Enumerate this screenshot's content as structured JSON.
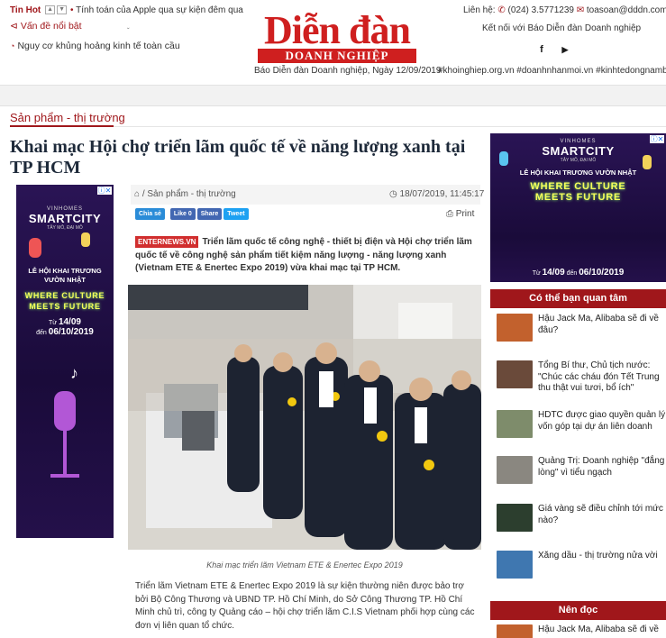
{
  "header": {
    "left_links": [
      "Vấn đề nổi bật",
      "Nguy cơ khủng hoảng kinh tế toàn cầu"
    ],
    "logo_main": "Diễn đàn",
    "logo_sub": "DOANH NGHIỆP",
    "date_line": "Báo Diễn đàn Doanh nghiệp, Ngày 12/09/2019",
    "connect": "Kết nối với Báo Diễn đàn Doanh nghiệp",
    "tags": "#khoinghiep.org.vn #doanhnhanmoi.vn #kinhtedongnambo.org"
  },
  "hotbar": {
    "label": "Tin Hot",
    "news": "Tính toán của Apple qua sự kiện đêm qua",
    "contact_label": "Liên hệ:",
    "phone": "(024) 3.5771239",
    "email": "toasoan@dddn.com.vn"
  },
  "article": {
    "category": "Sản phẩm - thị trường",
    "title": "Khai mạc Hội chợ triển lãm quốc tế về năng lượng xanh tại TP HCM",
    "breadcrumb": "Sản phẩm - thị trường",
    "timestamp": "18/07/2019, 11:45:17",
    "share": {
      "save": "Chia sẻ",
      "like": "Like 0",
      "share": "Share",
      "tweet": "Tweet",
      "print": "Print"
    },
    "source": "ENTERNEWS.VN",
    "sapo": "Triển lãm quốc tế công nghệ - thiết bị điện và Hội chợ triển lãm quốc tế về công nghệ sản phẩm tiết kiệm năng lượng - năng lượng xanh (Vietnam ETE & Enertec Expo 2019) vừa khai mạc tại TP HCM.",
    "caption": "Khai mạc triển lãm Vietnam ETE & Enertec Expo 2019",
    "body": "Triển lãm Vietnam ETE & Enertec Expo 2019 là sự kiện thường niên được bảo trợ bởi Bộ Công Thương và UBND TP. Hồ Chí Minh, do Sở Công Thương TP. Hồ Chí Minh chủ trì, công ty Quảng cáo – hội chợ triển lãm C.I.S Vietnam phối hợp cùng các đơn vị liên quan tổ chức."
  },
  "ad": {
    "brand_top": "VINHOMES",
    "brand": "SMARTCITY",
    "brand_sub": "TÂY MỖ, ĐẠI MỖ",
    "festival": "LỄ HỘI KHAI TRƯƠNG VƯỜN NHẬT",
    "slogan_1": "WHERE CULTURE",
    "slogan_2": "MEETS FUTURE",
    "date_from_label": "Từ",
    "date_from": "14/09",
    "date_to_label": "đến",
    "date_to": "06/10/2019"
  },
  "sidebar": {
    "related_title": "Có thể bạn quan tâm",
    "related": [
      {
        "title": "Hậu Jack Ma, Alibaba sẽ đi về đâu?",
        "thumb": "#c2612d"
      },
      {
        "title": "Tổng Bí thư, Chủ tịch nước: \"Chúc các cháu đón Tết Trung thu thật vui tươi, bổ ích\"",
        "thumb": "#6a4a3a"
      },
      {
        "title": "HDTC được giao quyền quản lý vốn góp tại dự án liên doanh",
        "thumb": "#7e8c6b"
      },
      {
        "title": "Quảng Trị: Doanh nghiệp \"đắng lòng\" vì tiểu ngạch",
        "thumb": "#8a8780"
      },
      {
        "title": "Giá vàng sẽ điều chỉnh tới mức nào?",
        "thumb": "#2c3e2e"
      },
      {
        "title": "Xăng dầu - thị trường nửa vời",
        "thumb": "#3f77b0"
      }
    ],
    "read_title": "Nên đọc",
    "read": [
      {
        "title": "Hậu Jack Ma, Alibaba sẽ đi về",
        "thumb": "#c2612d"
      }
    ]
  }
}
